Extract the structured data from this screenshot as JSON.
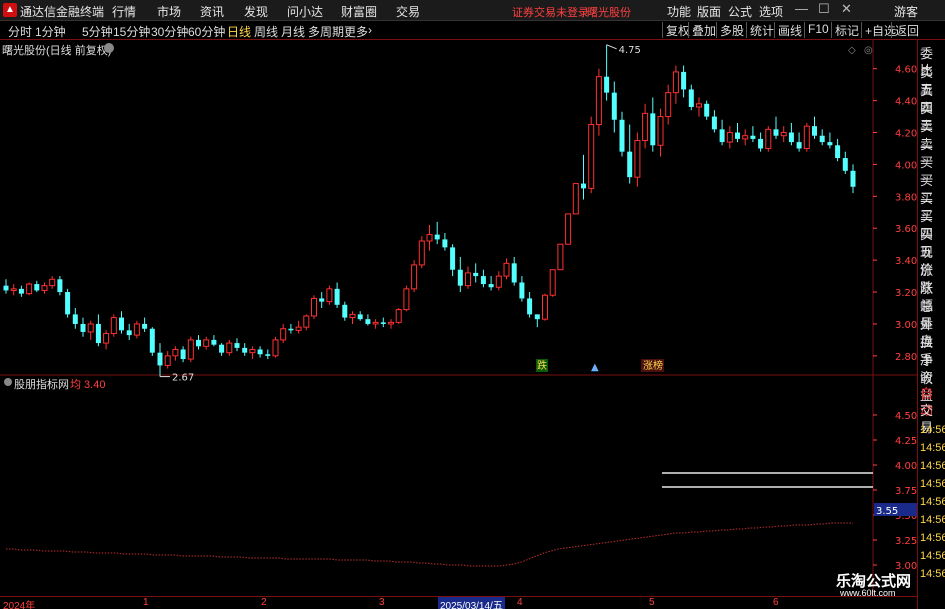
{
  "app": {
    "title": "通达信金融终端"
  },
  "menu": [
    "行情",
    "市场",
    "资讯",
    "发现",
    "问小达",
    "财富圈",
    "交易"
  ],
  "notice": "证券交易未登录",
  "stock_name_top": "曙光股份",
  "right_menu": [
    "功能",
    "版面",
    "公式",
    "选项"
  ],
  "user": "游客",
  "periods": [
    "分时",
    "1分钟",
    "5分钟",
    "15分钟",
    "30分钟",
    "60分钟",
    "日线",
    "周线",
    "月线",
    "多周期",
    "更多"
  ],
  "active_period": "日线",
  "tools": [
    "复权",
    "叠加",
    "多股",
    "统计",
    "画线",
    "F10",
    "标记",
    "+自选",
    "返回"
  ],
  "chart_title": "曙光股份(日线 前复权)",
  "price_axis": [
    "4.60",
    "4.40",
    "4.20",
    "4.00",
    "3.80",
    "3.60",
    "3.40",
    "3.20",
    "3.00",
    "2.80"
  ],
  "high_label": "4.75",
  "low_label": "2.67",
  "markers": {
    "m1": "跌",
    "m2": "涨榜"
  },
  "indicator": {
    "title": "股朋指标网",
    "value": "均 3.40"
  },
  "ind_axis": [
    "4.50",
    "4.25",
    "4.00",
    "3.75",
    "3.50",
    "3.25",
    "3.00"
  ],
  "ind_current": "3.55",
  "side_panel": [
    "委比",
    "卖五",
    "卖四",
    "卖三",
    "卖二",
    "卖一",
    "买一",
    "买二",
    "买三",
    "买四",
    "买五",
    "现价",
    "涨跌",
    "涨幅",
    "总量",
    "外盘",
    "换手",
    "净资",
    "收益"
  ],
  "side_lower": [
    "自动",
    "交易",
    "14:56",
    "14:56",
    "14:56",
    "14:56",
    "14:56",
    "14:56",
    "14:56",
    "14:56",
    "14:56"
  ],
  "x_axis": [
    "2024年",
    "1",
    "2",
    "3",
    "2025/03/14/五",
    "4",
    "5",
    "6"
  ],
  "watermark": {
    "line1": "乐淘公式网",
    "line2": "www.60lt.com"
  },
  "colors": {
    "up": "#ff3030",
    "down": "#54ffff",
    "axis": "#ff4040",
    "grid": "#7a1010"
  },
  "chart_data": {
    "type": "candlestick",
    "title": "曙光股份(日线 前复权)",
    "ylim": [
      2.68,
      4.78
    ],
    "y_ticks": [
      4.6,
      4.4,
      4.2,
      4.0,
      3.8,
      3.6,
      3.4,
      3.2,
      3.0,
      2.8
    ],
    "annotations": {
      "high": 4.75,
      "low": 2.67
    },
    "ohlc": [
      [
        3.24,
        3.28,
        3.19,
        3.21
      ],
      [
        3.21,
        3.25,
        3.18,
        3.22
      ],
      [
        3.22,
        3.24,
        3.17,
        3.19
      ],
      [
        3.19,
        3.26,
        3.18,
        3.25
      ],
      [
        3.25,
        3.27,
        3.2,
        3.21
      ],
      [
        3.21,
        3.26,
        3.19,
        3.24
      ],
      [
        3.24,
        3.3,
        3.22,
        3.28
      ],
      [
        3.28,
        3.3,
        3.18,
        3.2
      ],
      [
        3.2,
        3.22,
        3.04,
        3.06
      ],
      [
        3.06,
        3.1,
        2.97,
        3.0
      ],
      [
        3.0,
        3.04,
        2.92,
        2.95
      ],
      [
        2.95,
        3.02,
        2.9,
        3.0
      ],
      [
        3.0,
        3.06,
        2.86,
        2.88
      ],
      [
        2.88,
        2.96,
        2.84,
        2.94
      ],
      [
        2.94,
        3.06,
        2.92,
        3.04
      ],
      [
        3.04,
        3.08,
        2.94,
        2.96
      ],
      [
        2.96,
        3.0,
        2.9,
        2.93
      ],
      [
        2.93,
        3.02,
        2.91,
        3.0
      ],
      [
        3.0,
        3.04,
        2.95,
        2.97
      ],
      [
        2.97,
        2.98,
        2.8,
        2.82
      ],
      [
        2.82,
        2.88,
        2.67,
        2.74
      ],
      [
        2.74,
        2.83,
        2.72,
        2.8
      ],
      [
        2.8,
        2.86,
        2.77,
        2.84
      ],
      [
        2.84,
        2.86,
        2.76,
        2.78
      ],
      [
        2.78,
        2.92,
        2.76,
        2.9
      ],
      [
        2.9,
        2.93,
        2.84,
        2.86
      ],
      [
        2.86,
        2.92,
        2.84,
        2.9
      ],
      [
        2.9,
        2.93,
        2.86,
        2.87
      ],
      [
        2.87,
        2.88,
        2.8,
        2.82
      ],
      [
        2.82,
        2.9,
        2.8,
        2.88
      ],
      [
        2.88,
        2.91,
        2.83,
        2.85
      ],
      [
        2.85,
        2.88,
        2.8,
        2.82
      ],
      [
        2.82,
        2.86,
        2.78,
        2.84
      ],
      [
        2.84,
        2.86,
        2.79,
        2.81
      ],
      [
        2.81,
        2.84,
        2.78,
        2.8
      ],
      [
        2.8,
        2.92,
        2.79,
        2.9
      ],
      [
        2.9,
        3.0,
        2.88,
        2.97
      ],
      [
        2.97,
        3.0,
        2.94,
        2.96
      ],
      [
        2.96,
        3.02,
        2.94,
        2.98
      ],
      [
        2.98,
        3.06,
        2.96,
        3.05
      ],
      [
        3.05,
        3.18,
        3.03,
        3.16
      ],
      [
        3.16,
        3.2,
        3.1,
        3.14
      ],
      [
        3.14,
        3.24,
        3.12,
        3.22
      ],
      [
        3.22,
        3.26,
        3.1,
        3.12
      ],
      [
        3.12,
        3.14,
        3.02,
        3.04
      ],
      [
        3.04,
        3.08,
        3.0,
        3.06
      ],
      [
        3.06,
        3.08,
        3.02,
        3.03
      ],
      [
        3.03,
        3.06,
        2.99,
        3.0
      ],
      [
        3.0,
        3.03,
        2.97,
        3.01
      ],
      [
        3.01,
        3.04,
        2.98,
        3.0
      ],
      [
        3.0,
        3.03,
        2.97,
        3.01
      ],
      [
        3.01,
        3.1,
        3.0,
        3.09
      ],
      [
        3.09,
        3.24,
        3.08,
        3.22
      ],
      [
        3.22,
        3.4,
        3.2,
        3.37
      ],
      [
        3.37,
        3.55,
        3.35,
        3.52
      ],
      [
        3.52,
        3.62,
        3.46,
        3.56
      ],
      [
        3.56,
        3.64,
        3.5,
        3.53
      ],
      [
        3.53,
        3.57,
        3.46,
        3.48
      ],
      [
        3.48,
        3.5,
        3.3,
        3.34
      ],
      [
        3.34,
        3.42,
        3.2,
        3.24
      ],
      [
        3.24,
        3.36,
        3.22,
        3.32
      ],
      [
        3.32,
        3.38,
        3.26,
        3.3
      ],
      [
        3.3,
        3.34,
        3.23,
        3.25
      ],
      [
        3.25,
        3.3,
        3.21,
        3.23
      ],
      [
        3.23,
        3.33,
        3.21,
        3.3
      ],
      [
        3.3,
        3.41,
        3.28,
        3.38
      ],
      [
        3.38,
        3.42,
        3.24,
        3.26
      ],
      [
        3.26,
        3.3,
        3.14,
        3.16
      ],
      [
        3.16,
        3.2,
        3.04,
        3.06
      ],
      [
        3.06,
        3.06,
        2.98,
        3.03
      ],
      [
        3.03,
        3.19,
        3.02,
        3.18
      ],
      [
        3.18,
        3.34,
        3.17,
        3.34
      ],
      [
        3.34,
        3.5,
        3.34,
        3.5
      ],
      [
        3.5,
        3.69,
        3.5,
        3.69
      ],
      [
        3.69,
        3.88,
        3.69,
        3.88
      ],
      [
        3.88,
        4.06,
        3.78,
        3.85
      ],
      [
        3.85,
        4.3,
        3.82,
        4.25
      ],
      [
        4.25,
        4.6,
        4.18,
        4.55
      ],
      [
        4.55,
        4.75,
        4.4,
        4.45
      ],
      [
        4.45,
        4.52,
        4.2,
        4.28
      ],
      [
        4.28,
        4.33,
        4.05,
        4.08
      ],
      [
        4.08,
        4.25,
        3.88,
        3.92
      ],
      [
        3.92,
        4.2,
        3.86,
        4.15
      ],
      [
        4.15,
        4.38,
        4.1,
        4.32
      ],
      [
        4.32,
        4.42,
        4.08,
        4.12
      ],
      [
        4.12,
        4.35,
        4.05,
        4.3
      ],
      [
        4.3,
        4.5,
        4.25,
        4.45
      ],
      [
        4.45,
        4.62,
        4.38,
        4.58
      ],
      [
        4.58,
        4.62,
        4.42,
        4.47
      ],
      [
        4.47,
        4.5,
        4.34,
        4.36
      ],
      [
        4.36,
        4.42,
        4.3,
        4.38
      ],
      [
        4.38,
        4.4,
        4.28,
        4.3
      ],
      [
        4.3,
        4.34,
        4.2,
        4.22
      ],
      [
        4.22,
        4.28,
        4.12,
        4.14
      ],
      [
        4.14,
        4.24,
        4.1,
        4.2
      ],
      [
        4.2,
        4.26,
        4.14,
        4.16
      ],
      [
        4.16,
        4.22,
        4.12,
        4.18
      ],
      [
        4.18,
        4.24,
        4.14,
        4.16
      ],
      [
        4.16,
        4.2,
        4.08,
        4.1
      ],
      [
        4.1,
        4.24,
        4.08,
        4.22
      ],
      [
        4.22,
        4.3,
        4.16,
        4.18
      ],
      [
        4.18,
        4.24,
        4.14,
        4.2
      ],
      [
        4.2,
        4.26,
        4.12,
        4.14
      ],
      [
        4.14,
        4.2,
        4.08,
        4.1
      ],
      [
        4.1,
        4.26,
        4.08,
        4.24
      ],
      [
        4.24,
        4.3,
        4.16,
        4.18
      ],
      [
        4.18,
        4.22,
        4.12,
        4.14
      ],
      [
        4.14,
        4.2,
        4.1,
        4.12
      ],
      [
        4.12,
        4.16,
        4.02,
        4.04
      ],
      [
        4.04,
        4.08,
        3.94,
        3.96
      ],
      [
        3.96,
        4.0,
        3.82,
        3.86
      ]
    ],
    "indicator": {
      "name": "股朋指标网",
      "ylim": [
        2.95,
        4.75
      ],
      "y_ticks": [
        4.5,
        4.25,
        4.0,
        3.75,
        3.5,
        3.25,
        3.0
      ],
      "current": 3.55,
      "levels": [
        3.92,
        3.78
      ],
      "line": [
        3.16,
        3.16,
        3.15,
        3.15,
        3.15,
        3.14,
        3.14,
        3.14,
        3.14,
        3.13,
        3.13,
        3.13,
        3.12,
        3.12,
        3.12,
        3.12,
        3.11,
        3.11,
        3.11,
        3.11,
        3.1,
        3.1,
        3.1,
        3.1,
        3.09,
        3.09,
        3.09,
        3.09,
        3.09,
        3.08,
        3.08,
        3.08,
        3.08,
        3.07,
        3.07,
        3.07,
        3.07,
        3.07,
        3.06,
        3.06,
        3.06,
        3.06,
        3.06,
        3.06,
        3.06,
        3.05,
        3.05,
        3.05,
        3.05,
        3.05,
        3.04,
        3.04,
        3.04,
        3.03,
        3.03,
        3.03,
        3.02,
        3.02,
        3.01,
        3.01,
        3.0,
        3.0,
        3.0,
        2.99,
        2.99,
        2.99,
        2.99,
        2.99,
        3.0,
        3.01,
        3.03,
        3.06,
        3.09,
        3.12,
        3.14,
        3.16,
        3.17,
        3.18,
        3.19,
        3.2,
        3.21,
        3.22,
        3.23,
        3.24,
        3.25,
        3.26,
        3.27,
        3.28,
        3.29,
        3.3,
        3.31,
        3.32,
        3.32,
        3.33,
        3.33,
        3.34,
        3.34,
        3.35,
        3.35,
        3.36,
        3.36,
        3.37,
        3.37,
        3.38,
        3.38,
        3.39,
        3.39,
        3.4,
        3.4,
        3.4,
        3.41,
        3.41,
        3.42,
        3.42,
        3.42,
        3.42
      ]
    }
  }
}
